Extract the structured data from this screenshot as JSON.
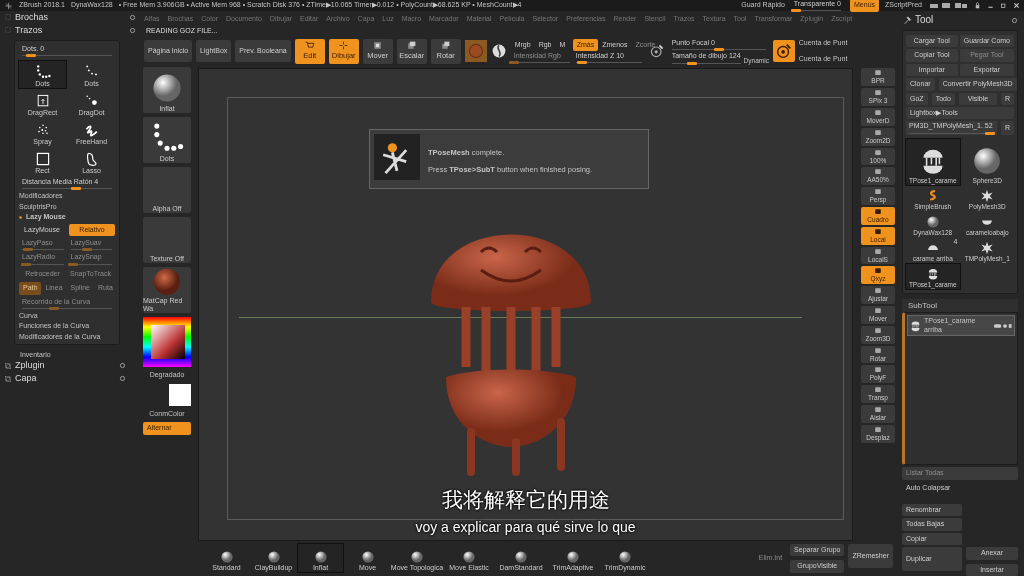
{
  "title_bar": {
    "app": "ZBrush 2018.1",
    "tool": "DynaWax128",
    "stats": "• Free Mem 3.906GB • Active Mem 968 • Scratch Disk 376 • ZTime▶10.065 Timer▶0.012 • PolyCount▶68.625 KP • MeshCount▶4",
    "quick_save": "Guard Rápido",
    "transparency": {
      "label": "Transparente 0",
      "level": 0.05
    },
    "menus": {
      "label": "Menús",
      "selected": true
    },
    "script": "ZScriptPred"
  },
  "left_palettes": [
    {
      "label": "Brochas"
    },
    {
      "label": "Trazos"
    }
  ],
  "stroke_panel": {
    "dots": {
      "label": "Dots. 0",
      "level": 0.1
    },
    "strokes": [
      {
        "label": "Dots",
        "kind": "dots",
        "selected": true
      },
      {
        "label": "Dots",
        "kind": "arc",
        "selected": false
      },
      {
        "label": "DragRect",
        "kind": "dragrect",
        "selected": false
      },
      {
        "label": "DragDot",
        "kind": "dragdot",
        "selected": false
      },
      {
        "label": "Spray",
        "kind": "spray",
        "selected": false
      },
      {
        "label": "FreeHand",
        "kind": "freehand",
        "selected": false
      },
      {
        "label": "Rect",
        "kind": "rect",
        "selected": false
      },
      {
        "label": "Lasso",
        "kind": "lasso",
        "selected": false
      }
    ],
    "mouse_distance": {
      "label": "Distancia Media Ratón 4",
      "level": 0.6
    },
    "sections": [
      "Modificadores",
      "SculptrisPro"
    ],
    "lazy_header": "Lazy Mouse",
    "lazy_mouse": {
      "label": "LazyMouse",
      "on": false
    },
    "relative": {
      "label": "Relativo",
      "on": true
    },
    "lazy_sliders": [
      {
        "label": "LazyPaso",
        "level": 0.15
      },
      {
        "label": "LazySuav",
        "level": 0.4
      },
      {
        "label": "LazyRadio",
        "level": 0.1
      },
      {
        "label": "LazySnap",
        "level": 0.05
      }
    ],
    "snap": [
      {
        "label": "Retroceder",
        "on": false
      },
      {
        "label": "SnapToTrack",
        "on": false
      }
    ],
    "path_modes": [
      {
        "label": "Path",
        "selected": true
      },
      {
        "label": "Linea",
        "selected": false
      },
      {
        "label": "Spline",
        "selected": false
      },
      {
        "label": "Ruta",
        "selected": false
      }
    ],
    "curve_step": {
      "label": "Recorrido de la Curva",
      "level": 0.35
    },
    "curve_sections": [
      "Curva",
      "Funciones de la Curva",
      "Modificadores de la Curva"
    ]
  },
  "inventory": "Inventario",
  "bottom_palettes": [
    {
      "label": "Zplugin"
    },
    {
      "label": "Capa"
    }
  ],
  "menu_bar": [
    "Alfas",
    "Brochas",
    "Color",
    "Documento",
    "Dibujar",
    "Editar",
    "Archivo",
    "Capa",
    "Luz",
    "Macro",
    "Marcador",
    "Material",
    "Película",
    "Selector",
    "Preferencias",
    "Render",
    "Stencil",
    "Trazos",
    "Textura",
    "Tool",
    "Transformar",
    "Zplugin",
    "Zscript"
  ],
  "status": "READING GOZ FILE...",
  "shelf": {
    "buttons": [
      "Página Inicio",
      "LightBox",
      "Prev. Booleana"
    ],
    "modes": [
      {
        "label": "Edit",
        "on": true,
        "kind": "edit"
      },
      {
        "label": "Dibujar",
        "on": true,
        "kind": "draw"
      },
      {
        "label": "Mover",
        "on": false,
        "kind": "move"
      },
      {
        "label": "Escalar",
        "on": false,
        "kind": "scale"
      },
      {
        "label": "Rotar",
        "on": false,
        "kind": "rotate"
      }
    ],
    "channels": [
      {
        "label": "Mrgb",
        "on": false,
        "disabled": false
      },
      {
        "label": "Rgb",
        "on": false,
        "disabled": false
      },
      {
        "label": "M",
        "on": false,
        "disabled": false
      },
      {
        "label": "Zmás",
        "on": true,
        "disabled": false
      },
      {
        "label": "Zmenos",
        "on": false,
        "disabled": false
      },
      {
        "label": "Zcorte",
        "on": false,
        "disabled": true
      }
    ],
    "rgb_intensity": {
      "label": "Intensidad Rgb",
      "level": 0.0
    },
    "z_intensity": {
      "label": "Intensidad Z 10",
      "level": 0.1
    },
    "focal": {
      "label": "Punto Focal 0",
      "level": 0.5
    },
    "draw_size": {
      "label": "Tamaño de dibujo 124",
      "level": 0.3
    },
    "dynamic": "Dynamic",
    "point_counts": [
      "Cuenta de Punt",
      "Cuenta de Punt"
    ]
  },
  "left_shelf": {
    "items": [
      {
        "label": "Inflat",
        "kind": "sphere"
      },
      {
        "label": "Dots",
        "kind": "dots"
      },
      {
        "label": "Alpha Off",
        "kind": "empty"
      },
      {
        "label": "Texture Off",
        "kind": "empty"
      },
      {
        "label": "MatCap Red Wa",
        "kind": "matcap"
      }
    ],
    "gradient": "Degradado",
    "color_switch": "ConmColor",
    "alternate": {
      "label": "Alternar",
      "on": true
    }
  },
  "popup": {
    "message": "**TPoseMesh** complete.",
    "hint": "Press **TPose>SubT** button when finished posing."
  },
  "subtitles": {
    "chinese": "我将解释它的用途",
    "spanish": "voy a explicar para qué sirve lo que"
  },
  "right_shelf": [
    {
      "label": "BPR",
      "on": false
    },
    {
      "label": "SPix 3",
      "on": false
    },
    {
      "label": "MoverD",
      "on": false
    },
    {
      "label": "Zoom2D",
      "on": false
    },
    {
      "label": "100%",
      "on": false
    },
    {
      "label": "AA50%",
      "on": false
    },
    {
      "label": "Persp",
      "on": false
    },
    {
      "label": "Cuadro",
      "on": true
    },
    {
      "label": "Local",
      "on": true
    },
    {
      "label": "LocalS",
      "on": false
    },
    {
      "label": "Qxyz",
      "on": true
    },
    {
      "label": "Ajustar",
      "on": false
    },
    {
      "label": "Mover",
      "on": false
    },
    {
      "label": "Zoom3D",
      "on": false
    },
    {
      "label": "Rotar",
      "on": false
    },
    {
      "label": "PolyF",
      "on": false
    },
    {
      "label": "Transp",
      "on": false
    },
    {
      "label": "Aislar",
      "on": false
    },
    {
      "label": "Desplaz",
      "on": false
    }
  ],
  "brushes": [
    {
      "label": "Standard",
      "selected": false
    },
    {
      "label": "ClayBuildup",
      "selected": false
    },
    {
      "label": "Inflat",
      "selected": true
    },
    {
      "label": "Move",
      "selected": false
    },
    {
      "label": "Move Topologica",
      "selected": false
    },
    {
      "label": "Move Elastic",
      "selected": false
    },
    {
      "label": "DamStandard",
      "selected": false
    },
    {
      "label": "TrimAdaptive",
      "selected": false
    },
    {
      "label": "TrimDynamic",
      "selected": false
    }
  ],
  "group_buttons": [
    {
      "label": "Elim.Int",
      "disabled": true
    },
    {
      "label": "Separar Grupo",
      "disabled": false
    },
    {
      "label": "GrupoVisible",
      "disabled": false
    }
  ],
  "remesher": "ZRemesher",
  "tool_panel": {
    "title": "Tool",
    "buttons": [
      {
        "label": "Cargar Tool",
        "disabled": false
      },
      {
        "label": "Guardar Como",
        "disabled": false
      },
      {
        "label": "Copiar Tool",
        "disabled": false
      },
      {
        "label": "Pegar Tool",
        "disabled": true
      },
      {
        "label": "Importar",
        "disabled": false
      },
      {
        "label": "Exportar",
        "disabled": false
      }
    ],
    "row2": [
      "Clonar",
      "Convertir PolyMesh3D"
    ],
    "row3": [
      "GoZ",
      "Todo",
      "Visible",
      "R"
    ],
    "lightbox": "Lightbox▶Tools",
    "current": {
      "label": "PM3D_TMPolyMesh_1. 52",
      "level": 0.95
    },
    "current_r": "R",
    "tools": [
      {
        "label": "TPose1_carame",
        "kind": "model",
        "selected": true
      },
      {
        "label": "Sphere3D",
        "kind": "sphere",
        "selected": false
      },
      {
        "label": "SimpleBrush",
        "kind": "brush",
        "selected": false
      },
      {
        "label": "PolyMesh3D",
        "kind": "star",
        "selected": false
      },
      {
        "label": "DynaWax128",
        "kind": "sphere",
        "selected": false
      },
      {
        "label": "carameloabajo",
        "kind": "bowl",
        "selected": false
      },
      {
        "label": "carame arriba",
        "kind": "dome",
        "selected": false,
        "badge": "4"
      },
      {
        "label": "TMPolyMesh_1",
        "kind": "star",
        "selected": false
      },
      {
        "label": "TPose1_carame",
        "kind": "model",
        "selected": true
      }
    ],
    "subtool_title": "SubTool",
    "subtools": [
      {
        "label": "TPose1_carame arriba",
        "selected": true
      }
    ],
    "list_all": {
      "label": "Listar Todas",
      "disabled": true
    },
    "auto_collapse": "Auto Colapsar",
    "actions": [
      "Renombrar",
      "Todas Bajas",
      "Copiar"
    ],
    "duplicate": "Duplicar",
    "append": "Anexar",
    "insert": "Insertar"
  }
}
